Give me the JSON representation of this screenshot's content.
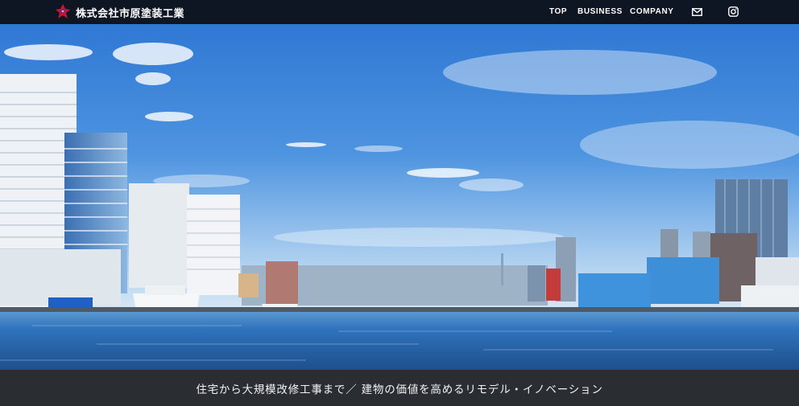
{
  "header": {
    "company_name": "株式会社市原塗装工業",
    "nav": [
      {
        "label": "TOP"
      },
      {
        "label": "BUSINESS"
      },
      {
        "label": "COMPANY"
      }
    ],
    "icons": [
      "mail-icon",
      "instagram-icon"
    ],
    "background": "#0f1623"
  },
  "hero": {
    "image": "city-waterfront-skyline-photo",
    "sky_color": "#3d82d6",
    "water_color": "#2f6fb8"
  },
  "tagline": {
    "text": "住宅から大規模改修工事まで／ 建物の価値を高めるリモデル・イノベーション",
    "background": "#2a2e33"
  }
}
